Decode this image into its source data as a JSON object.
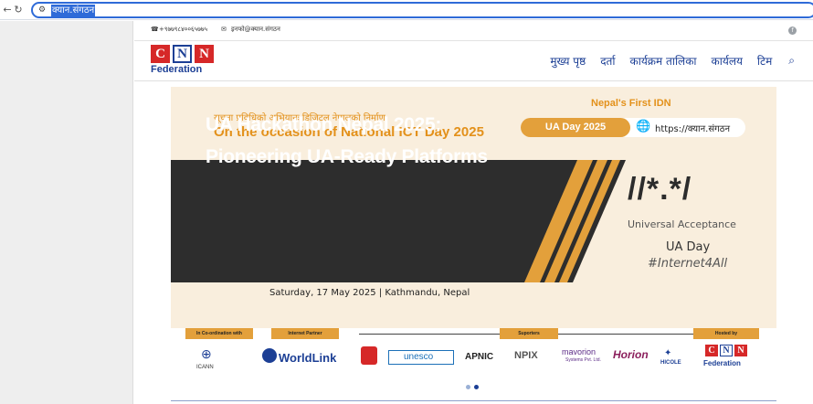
{
  "browser": {
    "back_icon": "arrow-left",
    "reload_icon": "reload",
    "site_info_icon": "tune-icon",
    "url": "क्यान.संगठन"
  },
  "topbar": {
    "phone": "+९७७९८४००६५७७५",
    "email": "इनफो@क्यान.संगठन"
  },
  "logo": {
    "letters": [
      "C",
      "N",
      "N"
    ],
    "subtitle": "Federation"
  },
  "menu": {
    "items": [
      "मुख्य पृष्ठ",
      "दर्ता",
      "कार्यक्रम तालिका",
      "कार्यलय",
      "टिम"
    ]
  },
  "banner": {
    "tagline_np": "सूचना प्रविधिको अभियानः डिजिटल नेपालको निर्माण",
    "occasion": "On the occasion of National ICT Day 2025",
    "first_idn": "Nepal's First IDN",
    "ua_day_label": "UA Day 2025",
    "idn_url": "https://क्यान.संगठन",
    "headline_1": "UA Hackathon Nepal 2025:",
    "headline_2": "Pioneering UA-Ready Platforms",
    "ua_symbol": "//*.*/",
    "ua_text": "Universal Acceptance",
    "ua_day": "UA Day",
    "hashtag": "#Internet4All",
    "date_line": "Saturday, 17 May 2025  |  Kathmandu, Nepal"
  },
  "partners": {
    "coord_label": "In Co-ordination with",
    "internet_label": "Internet Partner",
    "supporters_label": "Suporters",
    "hosted_label": "Hosted by",
    "icann": "ICANN",
    "worldlink": "WorldLink",
    "unesco": "unesco",
    "apnic": "APNIC",
    "npix": "NPIX",
    "mavorion": "mavorion",
    "mavorion_sub": "Systems Pvt. Ltd.",
    "horion": "Horion",
    "hicole": "HICOLE",
    "host_sub": "Federation"
  },
  "colors": {
    "accent": "#e3911b",
    "brand_blue": "#1c3f95",
    "brand_red": "#d62828",
    "dark_band": "#2d2d2d"
  }
}
